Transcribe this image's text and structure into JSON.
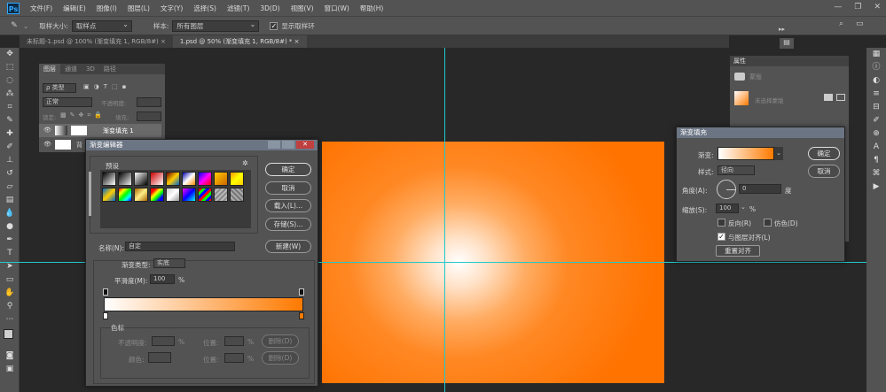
{
  "app": {
    "logo": "Ps"
  },
  "menu": [
    "文件(F)",
    "编辑(E)",
    "图像(I)",
    "图层(L)",
    "文字(Y)",
    "选择(S)",
    "滤镜(T)",
    "3D(D)",
    "视图(V)",
    "窗口(W)",
    "帮助(H)"
  ],
  "options": {
    "sample_size_label": "取样大小:",
    "sample_size_value": "取样点",
    "sample_label": "样本:",
    "sample_value": "所有图层",
    "show_ring_label": "显示取样环"
  },
  "tabs": [
    {
      "label": "未标题-1.psd @ 100% (渐变填充 1, RGB/8#)",
      "close": "×"
    },
    {
      "label": "1.psd @ 50% (渐变填充 1, RGB/8#) *",
      "close": "×"
    }
  ],
  "layers_panel": {
    "tabs": [
      "图层",
      "通道",
      "3D",
      "路径"
    ],
    "kind": "ρ 类型",
    "blend": "正常",
    "opacity": "不透明度:",
    "lock": "锁定:",
    "fill": "填充:",
    "layer1": "渐变填充 1",
    "layer2": "背"
  },
  "gradient_editor": {
    "title": "渐变编辑器",
    "presets_label": "预设",
    "ok": "确定",
    "cancel": "取消",
    "load": "载入(L)...",
    "save": "存储(S)...",
    "name_label": "名称(N):",
    "name_value": "自定",
    "new": "新建(W)",
    "type_label": "渐变类型:",
    "type_value": "实底",
    "smooth_label": "平滑度(M):",
    "smooth_value": "100",
    "percent": "%",
    "stops_label": "色标",
    "opacity_label": "不透明度:",
    "location_label": "位置:",
    "delete": "删除(D)",
    "color_label": "颜色:",
    "gradient_start": "#ffffff",
    "gradient_end": "#ff7a00"
  },
  "properties_panel": {
    "title": "属性",
    "sub": "蒙版",
    "mask_text": "未选择蒙版"
  },
  "gradient_fill": {
    "title": "渐变填充",
    "gradient_label": "渐变:",
    "ok": "确定",
    "cancel": "取消",
    "style_label": "样式:",
    "style_value": "径向",
    "angle_label": "角度(A):",
    "angle_value": "0",
    "degree": "度",
    "scale_label": "缩放(S):",
    "scale_value": "100",
    "percent": "%",
    "reverse": "反向(R)",
    "dither": "仿色(D)",
    "align": "与图层对齐(L)",
    "reset": "重置对齐"
  }
}
